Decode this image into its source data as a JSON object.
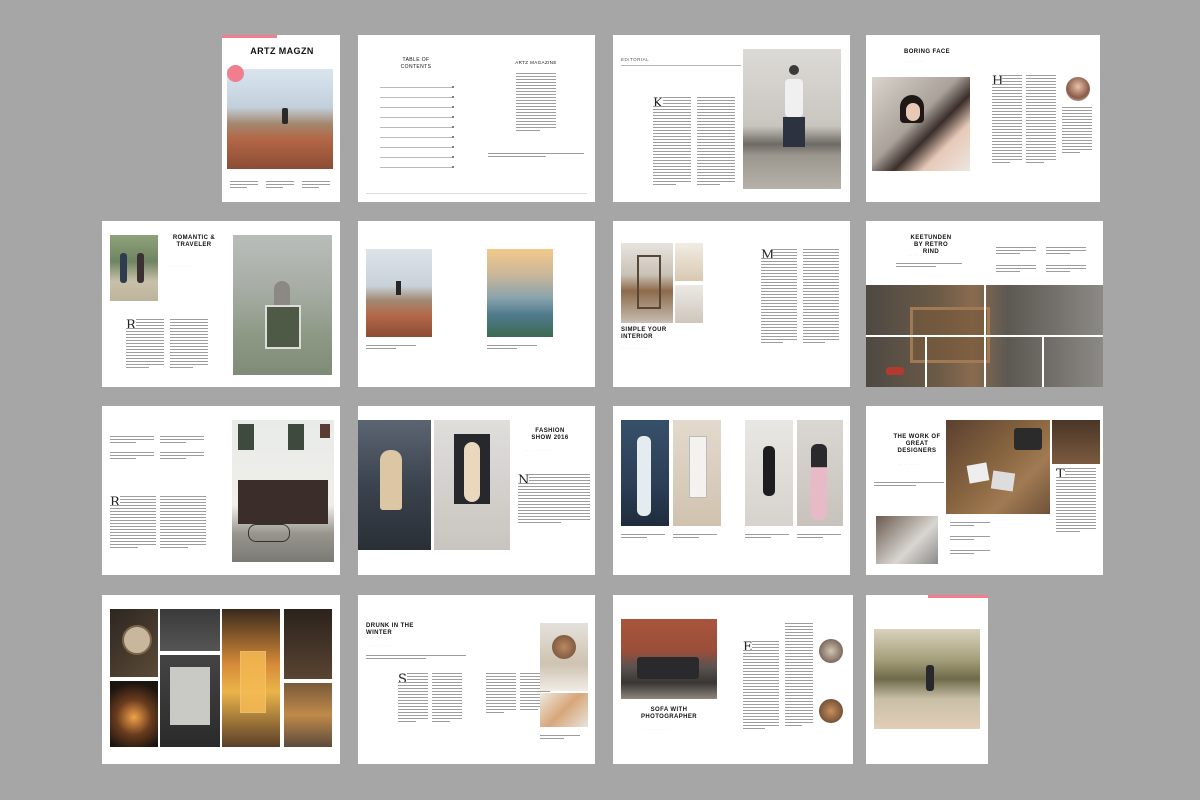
{
  "cover": {
    "title": "ARTZ MAGZN"
  },
  "toc": {
    "title": "TABLE OF CONTENTS",
    "magazine_name": "ARTZ MAGAZINE"
  },
  "editorial": {
    "label": "EDITORIAL"
  },
  "boring_face": {
    "title": "BORING FACE"
  },
  "romantic": {
    "title": "ROMANTIC & TRAVELER"
  },
  "interior": {
    "title": "SIMPLE YOUR INTERIOR"
  },
  "keetunden": {
    "title": "KEETUNDEN BY RETRO RIND"
  },
  "fashion": {
    "title": "FASHION SHOW 2016"
  },
  "designers": {
    "title": "THE WORK OF GREAT DESIGNERS"
  },
  "drunk": {
    "title": "DRUNK IN THE WINTER"
  },
  "sofa": {
    "title": "SOFA WITH PHOTOGRAPHER"
  },
  "colors": {
    "accent": "#f07f8e",
    "background": "#a6a6a6"
  }
}
